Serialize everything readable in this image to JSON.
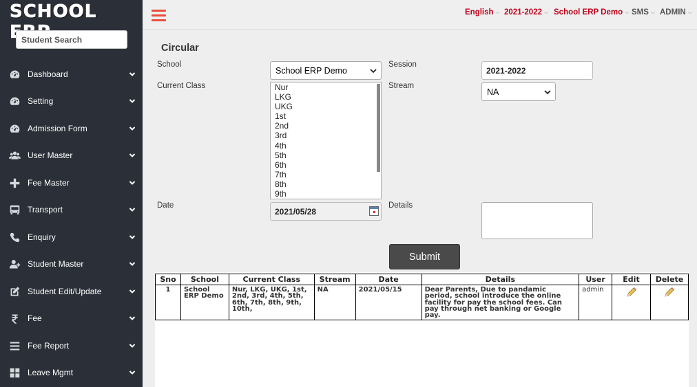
{
  "app": {
    "logo": "SCHOOL ERP"
  },
  "sidebar": {
    "search_placeholder": "Student Search",
    "items": [
      {
        "label": "Dashboard",
        "icon": "dashboard-icon"
      },
      {
        "label": "Setting",
        "icon": "dashboard-icon"
      },
      {
        "label": "Admission Form",
        "icon": "dashboard-icon"
      },
      {
        "label": "User Master",
        "icon": "users-icon"
      },
      {
        "label": "Fee Master",
        "icon": "plus-icon"
      },
      {
        "label": "Transport",
        "icon": "bus-icon"
      },
      {
        "label": "Enquiry",
        "icon": "phone-icon"
      },
      {
        "label": "Student Master",
        "icon": "user-add-icon"
      },
      {
        "label": "Student Edit/Update",
        "icon": "edit-icon"
      },
      {
        "label": "Fee",
        "icon": "rupee-icon"
      },
      {
        "label": "Fee Report",
        "icon": "list-icon"
      },
      {
        "label": "Leave Mgmt",
        "icon": "grid-icon"
      }
    ]
  },
  "topbar": {
    "language": "English",
    "session": "2021-2022",
    "school": "School ERP Demo",
    "sms": "SMS",
    "user": "ADMIN",
    "accent_color": "#c0001a"
  },
  "form": {
    "title": "Circular",
    "school_label": "School",
    "school_value": "School ERP Demo",
    "session_label": "Session",
    "session_value": "2021-2022",
    "class_label": "Current Class",
    "class_options": [
      "Nur",
      "LKG",
      "UKG",
      "1st",
      "2nd",
      "3rd",
      "4th",
      "5th",
      "6th",
      "7th",
      "8th",
      "9th"
    ],
    "stream_label": "Stream",
    "stream_value": "NA",
    "date_label": "Date",
    "date_value": "2021/05/28",
    "details_label": "Details",
    "details_value": "",
    "submit_label": "Submit"
  },
  "table": {
    "headers": [
      "Sno",
      "School",
      "Current Class",
      "Stream",
      "Date",
      "Details",
      "User",
      "Edit",
      "Delete"
    ],
    "rows": [
      {
        "sno": "1",
        "school": "School ERP Demo",
        "current_class": "Nur, LKG, UKG, 1st, 2nd, 3rd, 4th, 5th, 6th, 7th, 8th, 9th, 10th,",
        "stream": "NA",
        "date": "2021/05/15",
        "details": "Dear Parents, Due to pandamic period, school introduce the online facility for pay the school fees. Can pay through net banking or Google pay.",
        "user": "admin",
        "edit_icon": "pencil-icon",
        "delete_icon": "pencil-icon"
      }
    ]
  }
}
